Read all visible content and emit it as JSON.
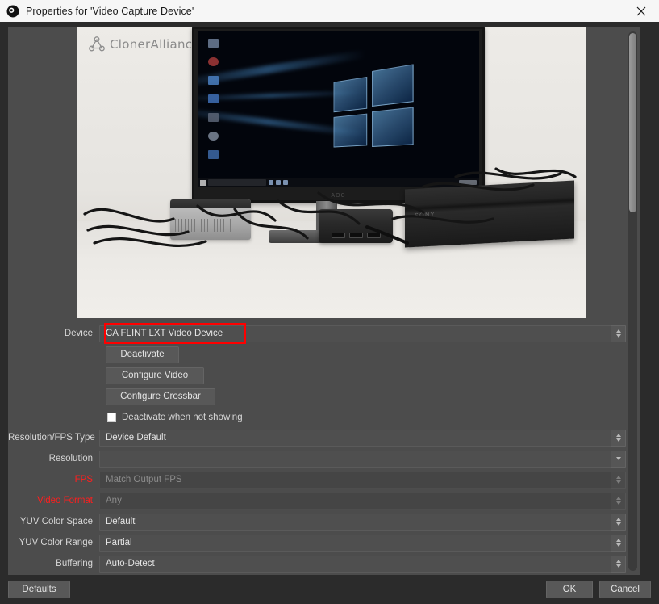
{
  "window": {
    "title": "Properties for 'Video Capture Device'",
    "logo_icon": "obs-logo-icon",
    "close_icon": "close-icon"
  },
  "preview": {
    "brand_text": "ClonerAlliance",
    "brand_tm": "™",
    "brand_mark_icon": "cloneralliance-molecule-icon",
    "monitor_brand": "AOC",
    "console_brand": "SONY",
    "description": "Live video capture preview showing a desk with an AOC monitor displaying a Windows 10 desktop, a silver mini PC, a black HDMI capture box and a PlayStation 4 Pro console with cables."
  },
  "form": {
    "device": {
      "label": "Device",
      "value": "CA FLINT LXT Video Device",
      "highlighted": true
    },
    "buttons": {
      "deactivate": "Deactivate",
      "configure_video": "Configure Video",
      "configure_crossbar": "Configure Crossbar"
    },
    "deactivate_when_not_showing": {
      "label": "Deactivate when not showing",
      "checked": false
    },
    "fields": [
      {
        "label": "Resolution/FPS Type",
        "value": "Device Default",
        "disabled": false,
        "label_red": false,
        "spinner": "updown"
      },
      {
        "label": "Resolution",
        "value": "",
        "disabled": false,
        "label_red": false,
        "spinner": "down"
      },
      {
        "label": "FPS",
        "value": "Match Output FPS",
        "disabled": true,
        "label_red": true,
        "spinner": "updown"
      },
      {
        "label": "Video Format",
        "value": "Any",
        "disabled": true,
        "label_red": true,
        "spinner": "updown"
      },
      {
        "label": "YUV Color Space",
        "value": "Default",
        "disabled": false,
        "label_red": false,
        "spinner": "updown"
      },
      {
        "label": "YUV Color Range",
        "value": "Partial",
        "disabled": false,
        "label_red": false,
        "spinner": "updown"
      },
      {
        "label": "Buffering",
        "value": "Auto-Detect",
        "disabled": false,
        "label_red": false,
        "spinner": "updown"
      }
    ]
  },
  "footer": {
    "defaults": "Defaults",
    "ok": "OK",
    "cancel": "Cancel"
  },
  "colors": {
    "titlebar_bg": "#f6f6f6",
    "dialog_bg": "#2b2b2b",
    "panel_bg": "#4c4c4c",
    "field_bg": "#4f4f4f",
    "text": "#d6d6d6",
    "accent_red": "#ff1e1e",
    "highlight_red": "#ff0000"
  }
}
